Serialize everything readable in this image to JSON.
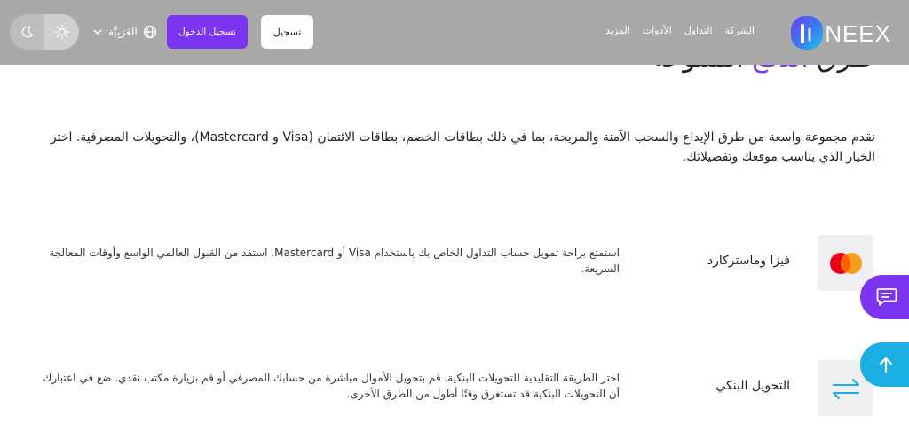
{
  "header": {
    "logo_text": "NEEX",
    "nav": [
      "الشركة",
      "التداول",
      "الأدوات",
      "المزيد"
    ],
    "register_label": "تسجيل",
    "login_label": "تسجيل الدخول",
    "language_label": "العَرَبِيَّة",
    "theme_options": [
      "light",
      "dark"
    ],
    "active_theme": "light"
  },
  "section": {
    "title_part1": "طرق ",
    "title_accent": "الدفع",
    "title_part2": " المتنوعة",
    "intro": "نقدم مجموعة واسعة من طرق الإيداع والسحب الآمنة والمريحة، بما في ذلك بطاقات الخصم، بطاقات الائتمان (Visa و Mastercard)، والتحويلات المصرفية. اختر الخيار الذي يناسب موقعك وتفضيلاتك."
  },
  "methods": [
    {
      "name": "فيزا وماستركارد",
      "description": "استمتع براحة تمويل حساب التداول الخاص بك باستخدام Visa أو Mastercard. استفد من القبول العالمي الواسع وأوقات المعالجة السريعة.",
      "icon": "mastercard-icon"
    },
    {
      "name": "التحويل البنكي",
      "description": "اختر الطريقة التقليدية للتحويلات البنكية. قم بتحويل الأموال مباشرة من حسابك المصرفي أو قم بزيارة مكتب نقدي. ضع في اعتبارك أن التحويلات البنكية قد تستغرق وقتًا أطول من الطرق الأخرى.",
      "icon": "bank-transfer-icon"
    }
  ],
  "colors": {
    "accent": "#7b34f0",
    "header_bg": "#a9a9a9",
    "scroll_top": "#1aaee3"
  }
}
